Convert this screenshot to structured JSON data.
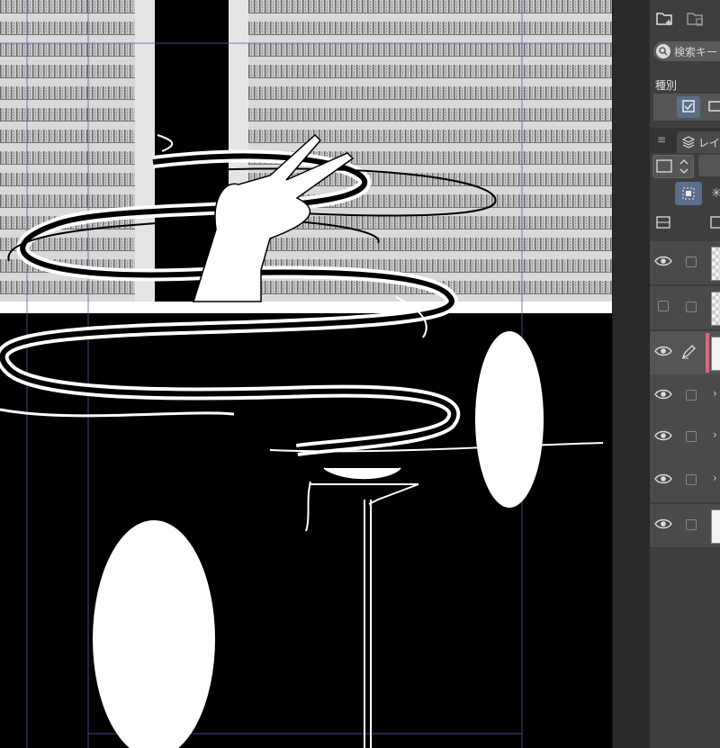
{
  "panel": {
    "search_placeholder": "検索キー",
    "kind_label": "種別",
    "layer_tab_label": "レイ",
    "icons": {
      "new_folder": "folder-plus-icon",
      "delete_folder": "folder-delete-icon",
      "search": "search-icon",
      "layer_tab": "layers-icon"
    },
    "layers": [
      {
        "visible": true,
        "type": "checker"
      },
      {
        "visible": false,
        "type": "checker"
      },
      {
        "visible": true,
        "type": "white",
        "active": true,
        "editing": true
      },
      {
        "visible": true,
        "type": "folder"
      },
      {
        "visible": true,
        "type": "folder"
      },
      {
        "visible": true,
        "type": "folder"
      },
      {
        "visible": true,
        "type": "white"
      }
    ]
  },
  "colors": {
    "canvas_bg": "#000000",
    "panel_bg": "#3e3e3e",
    "active_layer_marker": "#d06b7a",
    "selected_button": "#5a6e8c"
  }
}
